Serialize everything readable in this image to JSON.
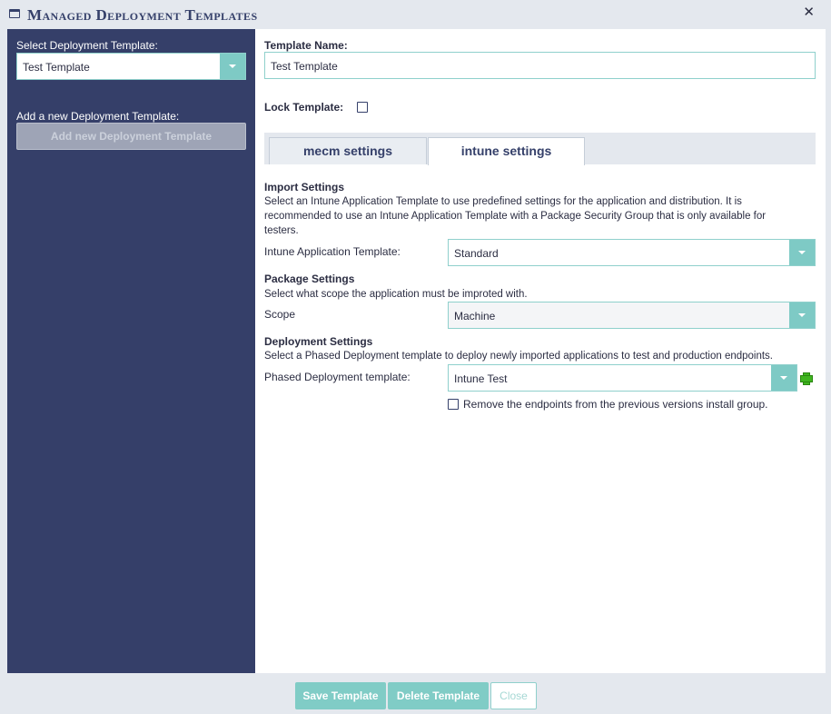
{
  "window": {
    "title": "Managed Deployment Templates",
    "close_glyph": "✕"
  },
  "sidebar": {
    "select_label": "Select Deployment Template:",
    "selected_template": "Test Template",
    "add_label": "Add a new Deployment Template:",
    "add_button": "Add new Deployment Template"
  },
  "main": {
    "template_name_label": "Template Name:",
    "template_name_value": "Test Template",
    "lock_label": "Lock Template:",
    "lock_checked": false,
    "tabs": [
      {
        "label": "mecm settings",
        "active": false
      },
      {
        "label": "intune settings",
        "active": true
      }
    ],
    "import": {
      "title": "Import Settings",
      "description_line1": "Select an Intune Application Template to use predefined settings for the application and distribution. It is",
      "description_line2": "recommended to use an Intune Application Template with a Package Security Group that is only available for",
      "description_line3": "testers.",
      "field_label": "Intune Application Template:",
      "field_value": "Standard"
    },
    "package": {
      "title": "Package Settings",
      "description": "Select what scope the application must be improted with.",
      "field_label": "Scope",
      "field_value": "Machine"
    },
    "deployment": {
      "title": "Deployment Settings",
      "description": "Select a Phased Deployment template to deploy newly imported applications to test and production endpoints.",
      "field_label": "Phased Deployment template:",
      "field_value": "Intune Test",
      "remove_checkbox_label": "Remove the endpoints from the previous versions install group.",
      "remove_checked": false
    }
  },
  "footer": {
    "save": "Save Template",
    "delete": "Delete Template",
    "close": "Close"
  },
  "colors": {
    "sidebar_bg": "#353f69",
    "accent_teal": "#7ecac5",
    "title_color": "#35406a",
    "plus_green": "#3fb51f"
  },
  "icons": [
    "window-icon",
    "close-icon",
    "chevron-down-icon",
    "add-plus-icon"
  ]
}
